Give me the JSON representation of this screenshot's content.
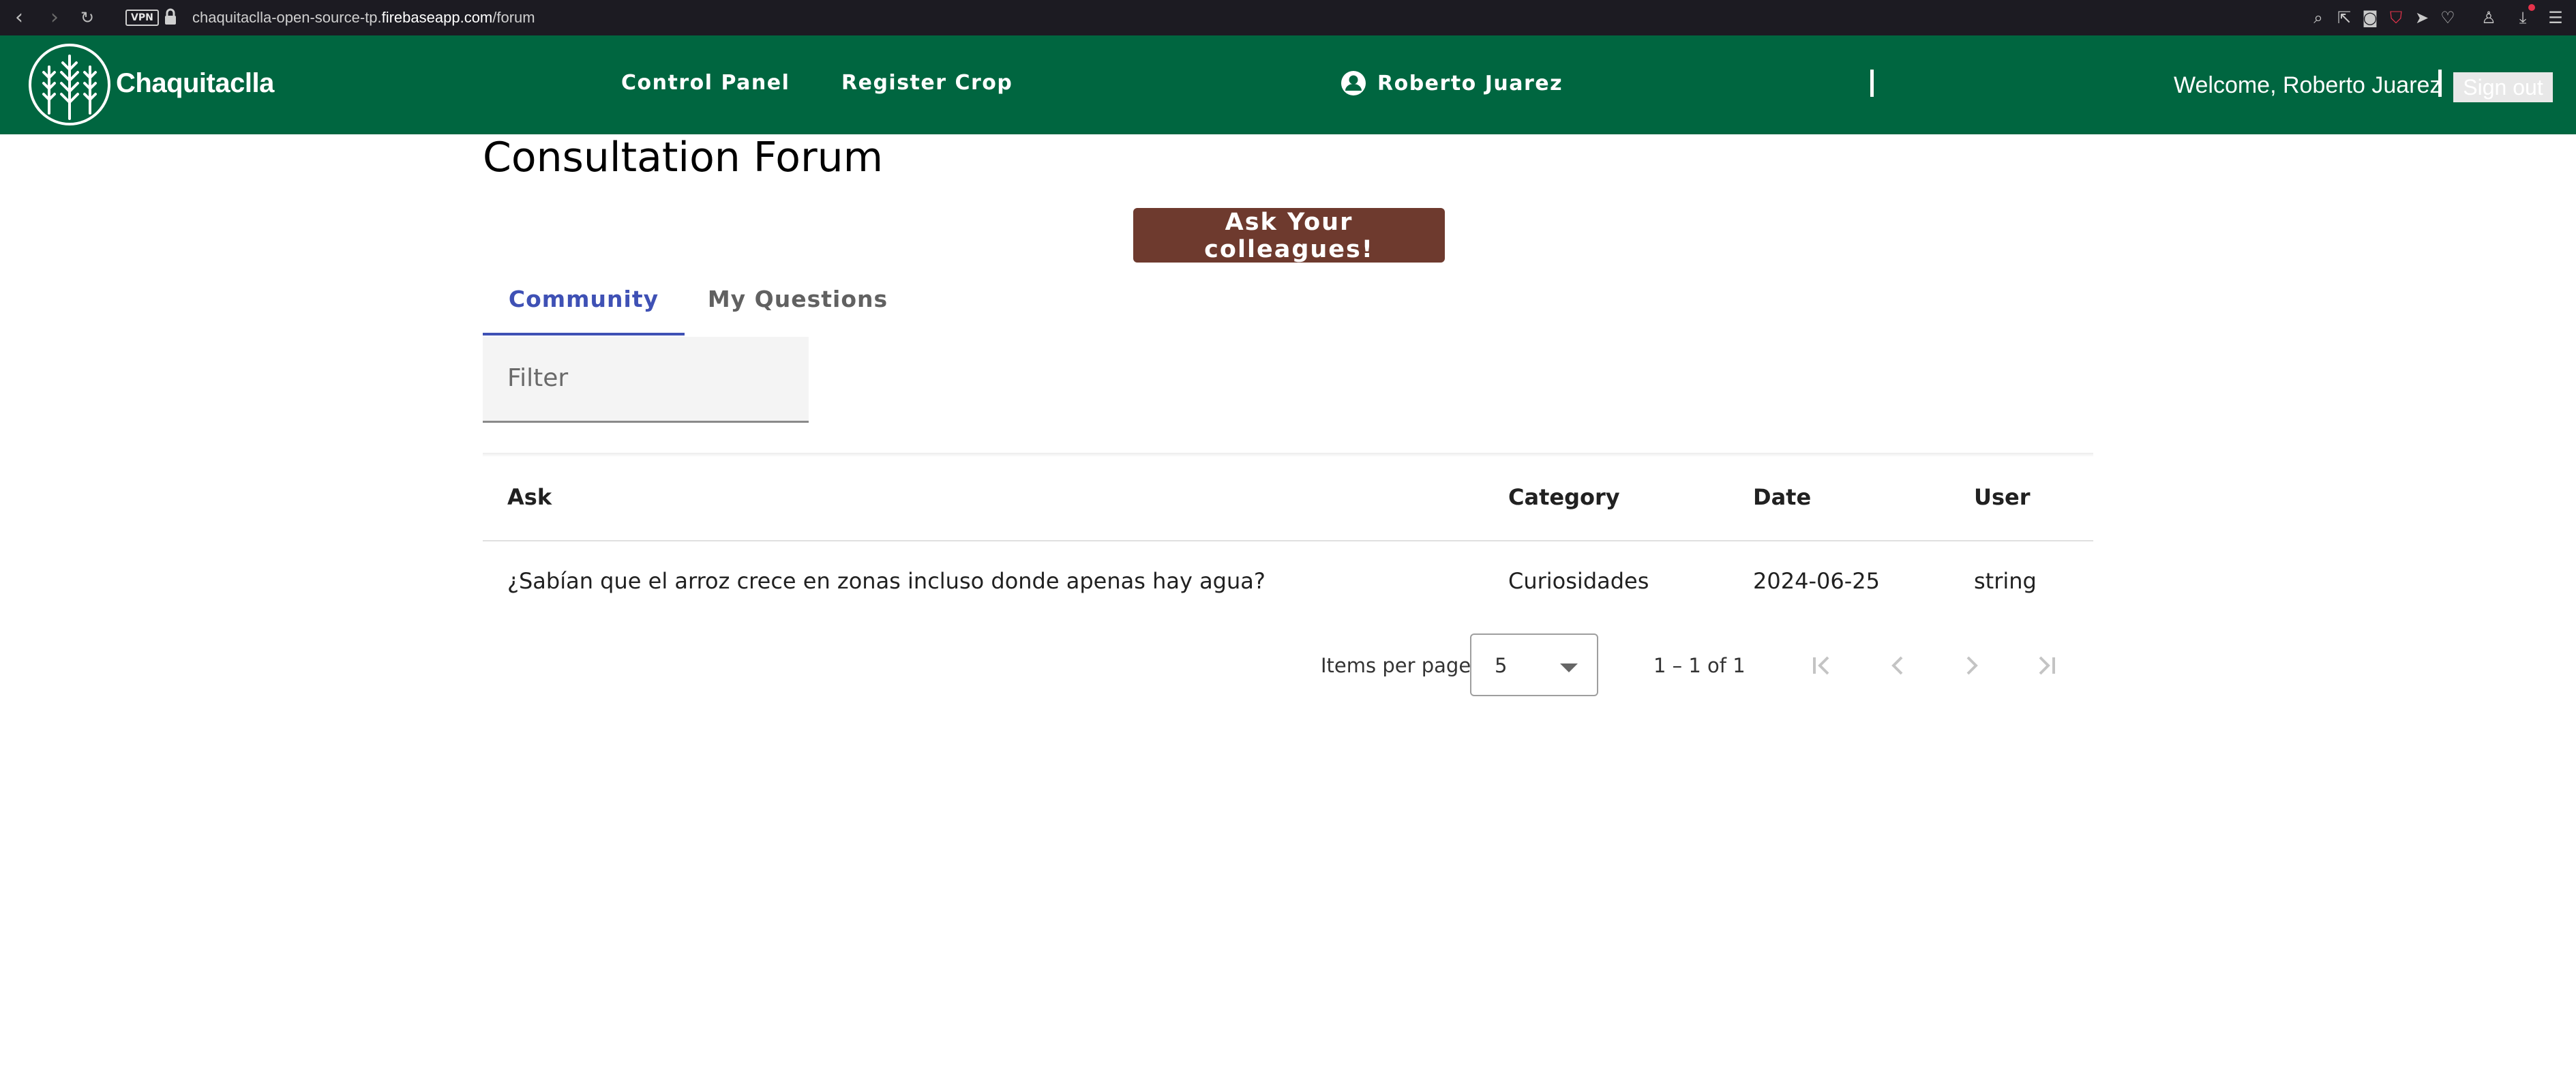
{
  "browser": {
    "vpn_badge": "VPN",
    "url_prefix": "chaquitaclla-open-source-tp.",
    "url_host": "firebaseapp.com",
    "url_path": "/forum"
  },
  "header": {
    "brand": "Chaquitaclla",
    "nav": [
      "Control Panel",
      "Register Crop"
    ],
    "user_name": "Roberto Juarez",
    "welcome": "Welcome, Roberto Juarez",
    "sign_out": "Sign out",
    "brand_color": "#006640"
  },
  "main": {
    "title": "Consultation Forum",
    "ask_button": "Ask Your colleagues!",
    "ask_button_color": "#6e3a2e",
    "tabs": [
      {
        "label": "Community",
        "active": true
      },
      {
        "label": "My Questions",
        "active": false
      }
    ],
    "filter_placeholder": "Filter",
    "table": {
      "columns": [
        "Ask",
        "Category",
        "Date",
        "User"
      ],
      "rows": [
        [
          "¿Sabían que el arroz crece en zonas incluso donde apenas hay agua?",
          "Curiosidades",
          "2024-06-25",
          "string"
        ]
      ]
    },
    "paginator": {
      "items_per_page_label": "Items per page:",
      "items_per_page_value": "5",
      "range": "1 – 1 of 1"
    }
  },
  "icons": [
    "back-icon",
    "forward-icon",
    "reload-icon",
    "lock-icon",
    "user-circle-icon",
    "first-page-icon",
    "previous-page-icon",
    "next-page-icon",
    "last-page-icon"
  ]
}
